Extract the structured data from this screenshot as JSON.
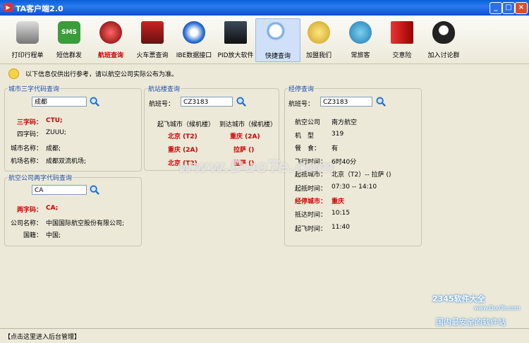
{
  "window": {
    "title": "TA客户端2.0"
  },
  "toolbar": {
    "items": [
      {
        "label": "打印行程单",
        "icon": "printer-icon"
      },
      {
        "label": "短信群发",
        "icon": "sms-icon"
      },
      {
        "label": "航班查询",
        "icon": "flight-query-icon"
      },
      {
        "label": "火车票查询",
        "icon": "train-icon"
      },
      {
        "label": "IBE数据接口",
        "icon": "ibe-globe-icon"
      },
      {
        "label": "PID放大软件",
        "icon": "pid-computer-icon"
      },
      {
        "label": "快捷查询",
        "icon": "magnifier-icon"
      },
      {
        "label": "加盟我们",
        "icon": "coins-icon"
      },
      {
        "label": "常旅客",
        "icon": "frequent-traveler-icon"
      },
      {
        "label": "交意险",
        "icon": "insurance-book-icon"
      },
      {
        "label": "加入讨论群",
        "icon": "qq-icon"
      }
    ]
  },
  "notice": "以下信息仅供出行参考，请以航空公司实际公布为准。",
  "city_panel": {
    "title": "城市三字代码查询",
    "input": "成都",
    "rows": [
      [
        "三字码：",
        "CTU;"
      ],
      [
        "四字码：",
        "ZUUU;"
      ],
      [
        "城市名称：",
        "成都;"
      ],
      [
        "机场名称：",
        "成都双流机场;"
      ]
    ]
  },
  "airline_panel": {
    "title": "航空公司两字代码查询",
    "input": "CA",
    "rows": [
      [
        "两字码：",
        "CA;"
      ],
      [
        "公司名称：",
        "中国国际航空股份有限公司;"
      ],
      [
        "国籍：",
        "中国;"
      ]
    ]
  },
  "terminal_panel": {
    "title": "航站楼查询",
    "flight_label": "航班号：",
    "input": "CZ3183",
    "col1": "起飞城市（候机楼）",
    "col2": "到达城市（候机楼）",
    "rows": [
      [
        "北京 (T2)",
        "重庆 (2A)"
      ],
      [
        "重庆 (2A)",
        "拉萨 ()"
      ],
      [
        "北京 (T2)",
        "拉萨 ()"
      ]
    ]
  },
  "stop_panel": {
    "title": "经停查询",
    "flight_label": "航班号：",
    "input": "CZ3183",
    "rows": [
      [
        "航空公司",
        "南方航空"
      ],
      [
        "机　型",
        "319"
      ],
      [
        "餐　食：",
        "有"
      ],
      [
        "飞行时间：",
        "6时40分"
      ],
      [
        "起抵城市：",
        "北京（T2）-- 拉萨 ()"
      ],
      [
        "起抵时间：",
        "07:30 -- 14:10"
      ],
      [
        "经停城市：",
        "重庆"
      ],
      [
        "抵达时间：",
        "10:15"
      ],
      [
        "起飞时间：",
        "11:40"
      ]
    ]
  },
  "status": "【点击这里进入后台管理】",
  "watermark": "www.DuoTe.com",
  "badge": {
    "brand": "2345软件大全",
    "url": "www.DuoTe.com",
    "slogan": "国内最安全的软件站"
  }
}
